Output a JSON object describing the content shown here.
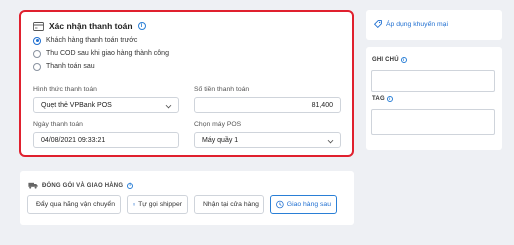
{
  "payment": {
    "title": "Xác nhận thanh toán",
    "options": [
      {
        "label": "Khách hàng thanh toán trước",
        "selected": true
      },
      {
        "label": "Thu COD sau khi giao hàng thành công",
        "selected": false
      },
      {
        "label": "Thanh toán sau",
        "selected": false
      }
    ],
    "method_label": "Hình thức thanh toán",
    "method_value": "Quẹt thẻ VPBank POS",
    "amount_label": "Số tiền thanh toán",
    "amount_value": "81,400",
    "date_label": "Ngày thanh toán",
    "date_value": "04/08/2021 09:33:21",
    "pos_label": "Chọn máy POS",
    "pos_value": "Máy quầy 1"
  },
  "sidebar": {
    "promo_label": "Áp dụng khuyến mại",
    "note_label": "GHI CHÚ",
    "tag_label": "TAG"
  },
  "shipping": {
    "title": "ĐÓNG GÓI VÀ GIAO HÀNG",
    "options": [
      {
        "label": "Đẩy qua hãng vận chuyển",
        "icon": "truck-icon",
        "selected": false
      },
      {
        "label": "Tự gọi shipper",
        "icon": "pin-icon",
        "selected": false
      },
      {
        "label": "Nhận tại cửa hàng",
        "icon": "store-icon",
        "selected": false
      },
      {
        "label": "Giao hàng sau",
        "icon": "clock-icon",
        "selected": true
      }
    ]
  },
  "colors": {
    "accent": "#1f6fd1",
    "highlight_border": "#e0202e"
  }
}
